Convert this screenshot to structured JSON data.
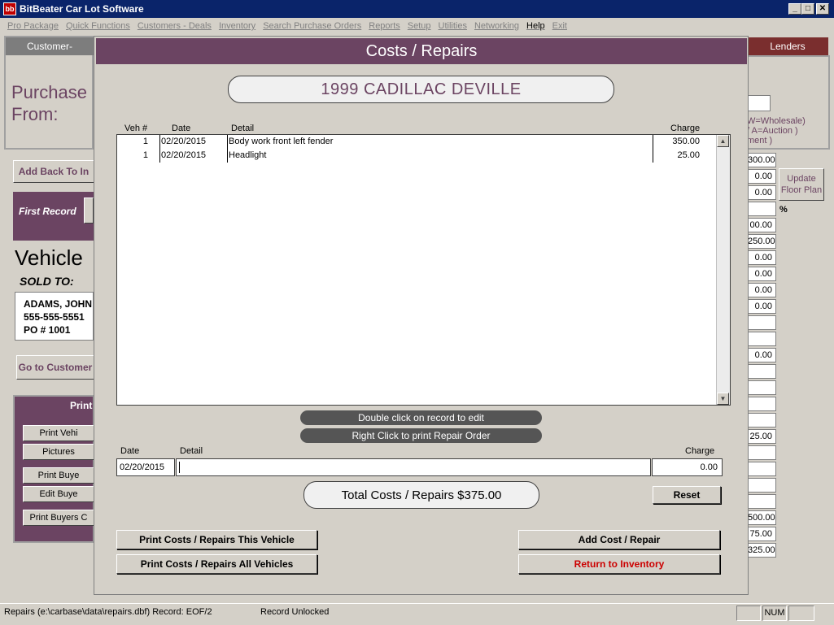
{
  "window": {
    "title": "BitBeater Car Lot Software",
    "icon": "bb-logo-icon",
    "buttons": [
      "_",
      "□",
      "✕"
    ]
  },
  "menu": [
    {
      "label": "Pro Package",
      "active": false
    },
    {
      "label": "Quick Functions",
      "active": false
    },
    {
      "label": "Customers - Deals",
      "active": false
    },
    {
      "label": "Inventory",
      "active": false
    },
    {
      "label": "Search Purchase Orders",
      "active": false
    },
    {
      "label": "Reports",
      "active": false
    },
    {
      "label": "Setup",
      "active": false
    },
    {
      "label": "Utilities",
      "active": false
    },
    {
      "label": "Networking",
      "active": false
    },
    {
      "label": "Help",
      "active": true
    },
    {
      "label": "Exit",
      "active": false
    }
  ],
  "background": {
    "tab_customer": "Customer-",
    "tab_lenders": "Lenders",
    "purchased_from": "Purchase\nFrom:",
    "wholesale_note": "W=Wholesale)",
    "auction_note": "/ A=Auction )",
    "ment_note": "ment )",
    "add_back": "Add Back To In",
    "first_record": "First Record",
    "vehicle": "Vehicle",
    "sold_to": "SOLD TO:",
    "buyer_name": "ADAMS, JOHN",
    "buyer_phone": "555-555-5551",
    "buyer_po": "PO # 1001",
    "go_to_customer": "Go to Customer",
    "print_header": "Print",
    "print_vehicle": "Print Vehi",
    "pictures": "Pictures",
    "print_buyer": "Print Buye",
    "edit_buyer": "Edit Buye",
    "print_buyers_c": "Print Buyers C",
    "update_floor_plan": "Update\nFloor Plan",
    "percent": "%",
    "right_fields": [
      "300.00",
      "0.00",
      "0.00",
      "",
      "00.00",
      "250.00",
      "0.00",
      "0.00",
      "0.00",
      "0.00",
      "",
      "",
      "0.00",
      "",
      "",
      "",
      "",
      "25.00",
      "",
      "",
      "",
      "",
      "500.00",
      "75.00",
      "325.00"
    ]
  },
  "dialog": {
    "title": "Costs / Repairs",
    "vehicle": "1999  CADILLAC DEVILLE",
    "columns": {
      "veh": "Veh #",
      "date": "Date",
      "detail": "Detail",
      "charge": "Charge"
    },
    "rows": [
      {
        "veh": "1",
        "date": "02/20/2015",
        "detail": "Body work front left fender",
        "charge": "350.00"
      },
      {
        "veh": "1",
        "date": "02/20/2015",
        "detail": "Headlight",
        "charge": "25.00"
      }
    ],
    "hint_edit": "Double click on record to edit",
    "hint_print": "Right Click to print Repair Order",
    "entry": {
      "date_label": "Date",
      "detail_label": "Detail",
      "charge_label": "Charge",
      "date_value": "02/20/2015",
      "detail_value": "",
      "charge_value": "0.00"
    },
    "total": "Total Costs / Repairs  $375.00",
    "reset": "Reset",
    "print_this": "Print Costs / Repairs This Vehicle",
    "print_all": "Print Costs / Repairs All Vehicles",
    "add": "Add Cost / Repair",
    "return": "Return to Inventory",
    "return_color": "#cc0000"
  },
  "status": {
    "file": "Repairs (e:\\carbase\\data\\repairs.dbf)  Record: EOF/2",
    "lock": "Record Unlocked",
    "num": "NUM"
  }
}
